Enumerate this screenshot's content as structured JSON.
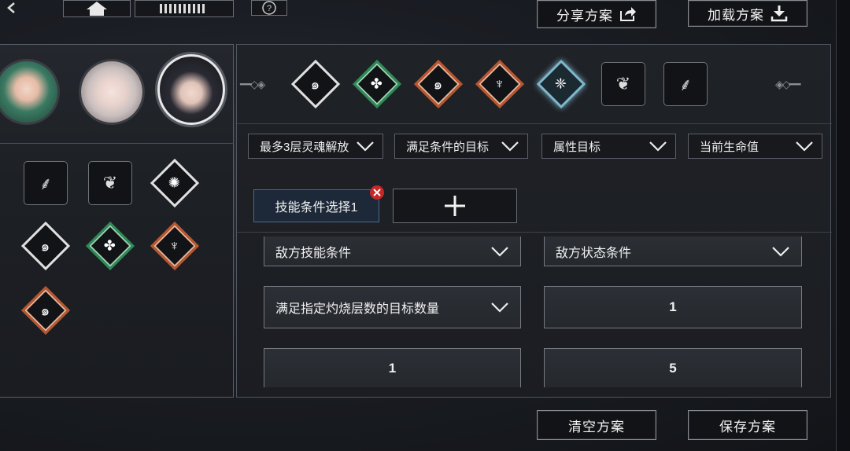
{
  "topbar": {
    "back_icon": "chevron-left-icon",
    "home_icon": "home-icon",
    "menu_icon": "grid-bars-icon",
    "help_icon": "question-circle-icon",
    "share_label": "分享方案",
    "load_label": "加载方案"
  },
  "characters": [
    {
      "name": "character-green-hair",
      "color": "#3a7a63"
    },
    {
      "name": "character-white-hair",
      "color": "#d9cfcf"
    },
    {
      "name": "character-black-hair",
      "color": "#2a2a33"
    }
  ],
  "left_skills": [
    {
      "icon": "scythe-icon",
      "style": "square"
    },
    {
      "icon": "butterfly-icon",
      "style": "square"
    },
    {
      "icon": "skill-diamond-white-icon",
      "style": "diamond-white"
    },
    {
      "icon": "skill-diamond-swirl-icon",
      "style": "diamond-white"
    },
    {
      "icon": "skill-diamond-green-icon",
      "style": "diamond-green"
    },
    {
      "icon": "skill-diamond-orange-icon",
      "style": "diamond-orange"
    },
    {
      "icon": "skill-diamond-orange-swirl-icon",
      "style": "diamond-orange"
    }
  ],
  "skill_bar": [
    {
      "icon": "skill-swirl-icon",
      "style": "diamond-white"
    },
    {
      "icon": "skill-leaf-icon",
      "style": "diamond-green"
    },
    {
      "icon": "skill-flame-icon",
      "style": "diamond-orange"
    },
    {
      "icon": "skill-spikes-icon",
      "style": "diamond-orange"
    },
    {
      "icon": "skill-crystal-icon",
      "style": "diamond-blue"
    },
    {
      "icon": "butterfly-icon",
      "style": "square"
    },
    {
      "icon": "scythe-icon",
      "style": "square"
    }
  ],
  "filters": [
    "最多3层灵魂解放",
    "满足条件的目标",
    "属性目标",
    "当前生命值"
  ],
  "condition_tab": {
    "label": "技能条件选择1",
    "add_icon": "plus-icon",
    "close_icon": "close-icon"
  },
  "condition_fields": {
    "enemy_skill": "敌方技能条件",
    "enemy_status": "敌方状态条件",
    "burn_target_count": "满足指定灼烧层数的目标数量",
    "value_1": "1",
    "value_2": "1",
    "value_3": "5"
  },
  "bottom": {
    "clear_label": "清空方案",
    "save_label": "保存方案"
  },
  "colors": {
    "accent_green": "#2f8a57",
    "accent_orange": "#b8562e",
    "accent_blue": "#7fb8cc",
    "close_red": "#c62828"
  }
}
